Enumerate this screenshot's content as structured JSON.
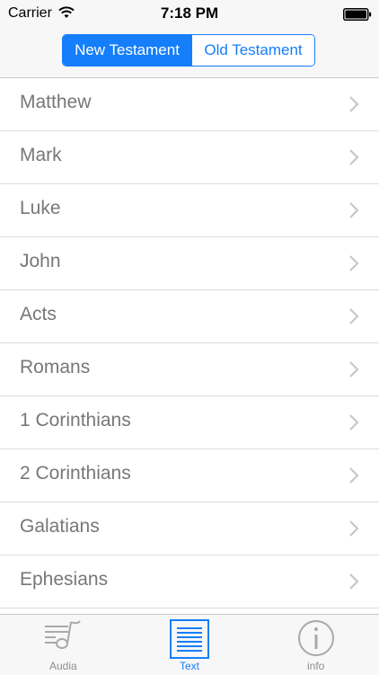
{
  "status_bar": {
    "carrier": "Carrier",
    "time": "7:18 PM"
  },
  "segments": {
    "new_testament": "New Testament",
    "old_testament": "Old Testament",
    "selected": "new_testament"
  },
  "books": [
    {
      "label": "Matthew"
    },
    {
      "label": "Mark"
    },
    {
      "label": "Luke"
    },
    {
      "label": "John"
    },
    {
      "label": "Acts"
    },
    {
      "label": "Romans"
    },
    {
      "label": "1 Corinthians"
    },
    {
      "label": "2 Corinthians"
    },
    {
      "label": "Galatians"
    },
    {
      "label": "Ephesians"
    }
  ],
  "tabs": [
    {
      "label": "Audia",
      "icon": "music-note-icon"
    },
    {
      "label": "Text",
      "icon": "document-icon",
      "active": true
    },
    {
      "label": "info",
      "icon": "info-icon"
    }
  ],
  "colors": {
    "accent": "#147efb",
    "row_text": "#777777",
    "inactive_tab": "#8e8e93"
  }
}
